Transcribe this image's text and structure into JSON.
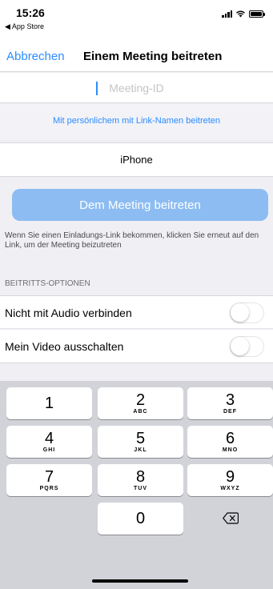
{
  "status_bar": {
    "time": "15:26",
    "back_app": "◀ App Store"
  },
  "nav": {
    "cancel_label": "Abbrechen",
    "title": "Einem Meeting beitreten"
  },
  "meeting_id": {
    "placeholder": "Meeting-ID",
    "value": ""
  },
  "link_name_label": "Mit persönlichem mit Link-Namen beitreten",
  "display_name": {
    "value": "iPhone"
  },
  "join_button_label": "Dem Meeting beitreten",
  "hint_text": "Wenn Sie einen Einladungs-Link bekommen, klicken Sie erneut auf den Link, um der Meeting beizutreten",
  "options": {
    "header": "BEITRITTS-OPTIONEN",
    "audio": {
      "label": "Nicht mit Audio verbinden",
      "on": false
    },
    "video": {
      "label": "Mein Video ausschalten",
      "on": false
    }
  },
  "keyboard": {
    "keys": [
      {
        "num": "1",
        "letters": ""
      },
      {
        "num": "2",
        "letters": "ABC"
      },
      {
        "num": "3",
        "letters": "DEF"
      },
      {
        "num": "4",
        "letters": "GHI"
      },
      {
        "num": "5",
        "letters": "JKL"
      },
      {
        "num": "6",
        "letters": "MNO"
      },
      {
        "num": "7",
        "letters": "PQRS"
      },
      {
        "num": "8",
        "letters": "TUV"
      },
      {
        "num": "9",
        "letters": "WXYZ"
      },
      {
        "num": "0",
        "letters": ""
      }
    ],
    "backspace_icon": "backspace-icon"
  },
  "colors": {
    "accent": "#2d8cff",
    "join_button_disabled": "#8cbcf2",
    "keyboard_bg": "#d1d3d9"
  }
}
